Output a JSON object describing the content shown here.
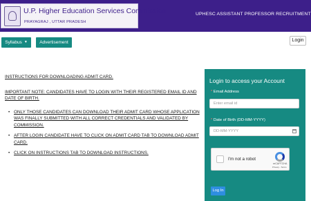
{
  "header": {
    "brand_title": "U.P. Higher Education Services Commission",
    "brand_subtitle": "PRAYAGRAJ , UTTAR PRADESH",
    "page_title": "UPHESC ASSISTANT PROFESSOR RECRUITMENT"
  },
  "nav": {
    "syllabus_label": "Syllabus",
    "advertisement_label": "Advertisement",
    "login_label": "Login"
  },
  "instructions": {
    "heading": "INSTRUCTIONS FOR DOWNLOADING ADMIT CARD.",
    "note": "IMPORTANT NOTE: CANDIDATES HAVE TO LOGIN WITH THEIR REGISTERED EMAIL ID AND DATE OF BIRTH.",
    "items": [
      "ONLY THOSE CANDIDATES CAN DOWNLOAD THEIR ADMIT CARD WHOSE APPLICATION WAS FINALLY SUBMITTED WITH ALL CORRECT CREDENTIALS AND VALIDATED BY COMMISSION.",
      "AFTER LOGIN CANDIDATE HAVE TO CLICK ON ADMIT CARD TAB TO DOWNLOAD ADMIT CARD.",
      "CLICK ON INSTRUCTIONS TAB TO DOWNLOAD INSTRUCTIONS."
    ]
  },
  "login_panel": {
    "title": "Login to access your Account",
    "email_label": "Email Address",
    "email_placeholder": "Enter email id",
    "dob_label": "Date of Birth (DD-MM-YYYY)",
    "dob_placeholder": "DD-MM-YYYY",
    "captcha_text": "I'm not a robot",
    "captcha_brand": "reCAPTCHA",
    "captcha_terms": "Privacy - Terms",
    "submit_label": "Log In"
  },
  "colors": {
    "header_bg": "#3d1f8a",
    "teal": "#168a82",
    "login_button": "#2e8ee0"
  }
}
